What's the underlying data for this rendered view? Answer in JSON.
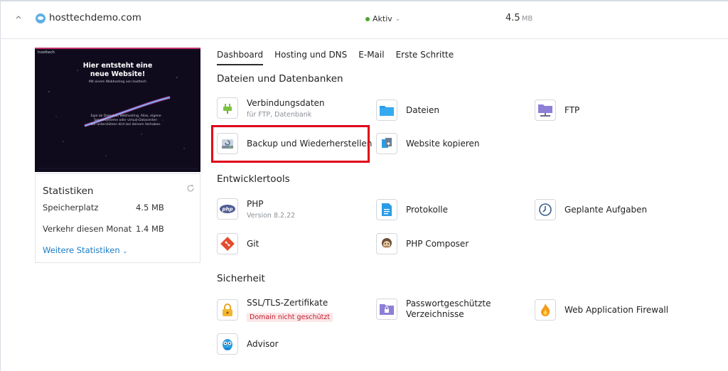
{
  "header": {
    "domain": "hosttechdemo.com",
    "status": "Aktiv",
    "status_color": "#4aa82f",
    "size_value": "4.5",
    "size_unit": "MB",
    "icons": [
      "chevron-up-icon",
      "domain-icon",
      "status-dropdown-icon"
    ]
  },
  "preview": {
    "brand": "hosttech",
    "headline_line1": "Hier entsteht eine",
    "headline_line2": "neue Website!",
    "subline": "Mit einem Webhosting von hosttech",
    "body_line1": "Egal ob Domains, Webhosting, Alias, eigene",
    "body_line2": "Serversysteme oder virtual-Datacenter:",
    "body_line3": "Wir unterstützen dich bei deinem Vorhaben."
  },
  "stats": {
    "title": "Statistiken",
    "storage_label": "Speicherplatz",
    "storage_value": "4.5 MB",
    "traffic_label": "Verkehr diesen Monat",
    "traffic_value": "1.4 MB",
    "more_label": "Weitere Statistiken"
  },
  "tabs": [
    "Dashboard",
    "Hosting und DNS",
    "E-Mail",
    "Erste Schritte"
  ],
  "sections": {
    "files": {
      "title": "Dateien und Datenbanken",
      "tiles": [
        {
          "label": "Verbindungsdaten",
          "sublabel": "für FTP, Datenbank",
          "icon": "plug-icon"
        },
        {
          "label": "Dateien",
          "icon": "folder-icon"
        },
        {
          "label": "FTP",
          "icon": "ftp-folder-icon"
        },
        {
          "label": "Backup und Wiederherstellen",
          "icon": "backup-drive-icon"
        },
        {
          "label": "Website kopieren",
          "icon": "copy-website-icon"
        }
      ]
    },
    "dev": {
      "title": "Entwicklertools",
      "tiles": [
        {
          "label": "PHP",
          "sublabel": "Version 8.2.22",
          "icon": "php-icon"
        },
        {
          "label": "Protokolle",
          "icon": "document-icon"
        },
        {
          "label": "Geplante Aufgaben",
          "icon": "clock-icon"
        },
        {
          "label": "Git",
          "icon": "git-icon"
        },
        {
          "label": "PHP Composer",
          "icon": "composer-icon"
        }
      ]
    },
    "security": {
      "title": "Sicherheit",
      "tiles": [
        {
          "label": "SSL/TLS-Zertifikate",
          "badge": "Domain nicht geschützt",
          "icon": "lock-icon"
        },
        {
          "label_line1": "Passwortgeschützte",
          "label_line2": "Verzeichnisse",
          "icon": "protected-folder-icon"
        },
        {
          "label": "Web Application Firewall",
          "icon": "fire-icon"
        },
        {
          "label": "Advisor",
          "icon": "owl-icon"
        }
      ]
    }
  },
  "colors": {
    "accent_link": "#1a7cc4",
    "highlight": "#e0001a",
    "badge_red": "#c01a2a"
  }
}
